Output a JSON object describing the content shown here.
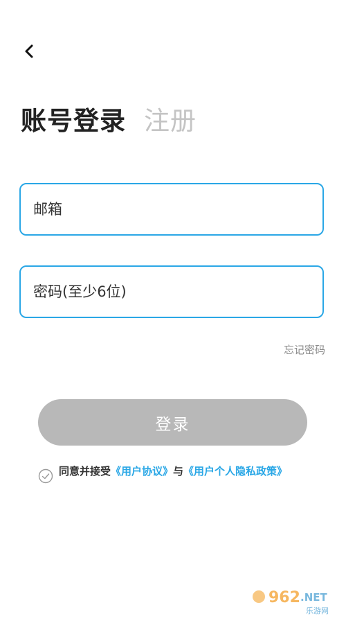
{
  "nav": {
    "back_icon": "chevron-left-icon"
  },
  "tabs": {
    "login": "账号登录",
    "register": "注册"
  },
  "form": {
    "email_placeholder": "邮箱",
    "password_placeholder": "密码(至少6位)",
    "forgot_label": "忘记密码",
    "login_label": "登录"
  },
  "agreement": {
    "check_icon": "check-circle-icon",
    "prefix": "同意并接受",
    "user_agreement": "《用户协议》",
    "connector": "与",
    "privacy_policy": "《用户个人隐私政策》"
  },
  "watermark": {
    "text": "962.NET",
    "subtext": "乐游网"
  },
  "colors": {
    "accent": "#2aa7e6",
    "button_disabled": "#b8b8b8",
    "inactive_tab": "#c4c4c4"
  }
}
